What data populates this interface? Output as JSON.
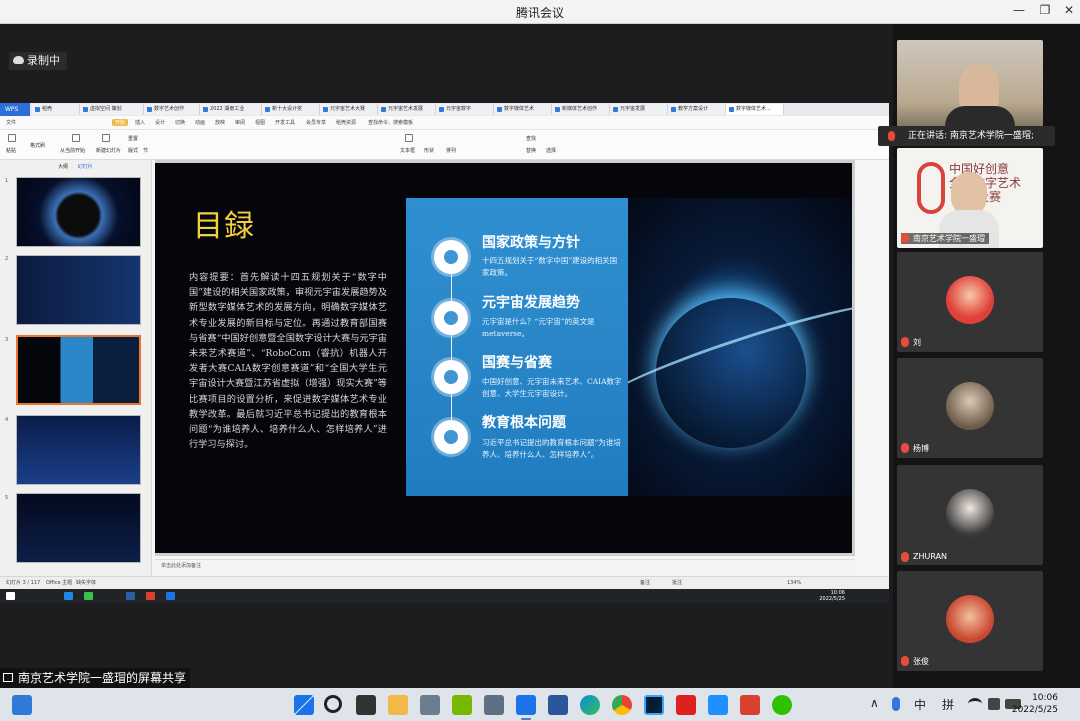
{
  "window": {
    "title": "腾讯会议",
    "controls": [
      "—",
      "❐",
      "✕"
    ]
  },
  "recording": {
    "label": "录制中"
  },
  "share_caption": "南京艺术学院一盛瑁的屏幕共享",
  "speaking": {
    "label": "正在讲话: 南京艺术学院一盛瑁;"
  },
  "wps": {
    "logo": "WPS",
    "tabs": [
      "WPS",
      "稻壳",
      "虚拟空间 策划",
      "数字艺术创作",
      "2022 湖南工业",
      "新十大设计奖",
      "元宇宙艺术大赛",
      "元宇宙艺术发展",
      "元宇宙数字",
      "数字媒体艺术",
      "新媒体艺术创作",
      "元宇宙发展",
      "教学方案设计",
      "数字媒体艺术..."
    ],
    "menu": [
      "文件",
      "开始",
      "插入",
      "设计",
      "切换",
      "动画",
      "放映",
      "审阅",
      "视图",
      "开发工具",
      "会员专享",
      "稻壳资源",
      "查找命令、搜索模板"
    ],
    "active_menu": "开始",
    "ribbon_items": [
      "粘贴",
      "格式刷",
      "从当前开始",
      "新建幻灯片",
      "版式",
      "重置",
      "节",
      "文本框",
      "形状",
      "排列",
      "查找",
      "替换",
      "选择"
    ],
    "panel_tabs": [
      "大纲",
      "幻灯片"
    ],
    "slide_numbers": [
      "1",
      "2",
      "3",
      "4",
      "5"
    ],
    "notes_placeholder": "单击此处添加备注",
    "status": {
      "slide_counter": "幻灯片 3 / 117",
      "theme": "Office 主题",
      "font": "缺失字体",
      "zoom": "134%",
      "notes": "备注",
      "comment": "批注"
    },
    "clock": {
      "time": "10:06",
      "date": "2022/5/25"
    }
  },
  "slide": {
    "title": "目録",
    "body": "内容提要：首先解读十四五规划关于“数字中国”建设的相关国家政策，审视元宇宙发展趋势及新型数字媒体艺术的发展方向，明确数字媒体艺术专业发展的新目标与定位。再通过教育部国赛与省赛“中国好创意暨全国数字设计大赛与元宇宙未来艺术赛道”、“RoboCom（睿抗）机器人开发者大赛CAIA数字创意赛道”和“全国大学生元宇宙设计大赛暨江苏省虚拟（增强）现实大赛”等比赛项目的设置分析，来促进数字媒体艺术专业教学改革。最后就习近平总书记提出的教育根本问题“为谁培养人、培养什么人、怎样培养人”进行学习与探讨。",
    "toc": [
      {
        "heading": "国家政策与方针",
        "desc": "十四五规划关于“数字中国”建设的相关国家政策。"
      },
      {
        "heading": "元宇宙发展趋势",
        "desc": "元宇宙是什么？“元宇宙”的英文是metaverse。"
      },
      {
        "heading": "国赛与省赛",
        "desc": "中国好创意、元宇宙未来艺术、CAIA数字创意、大学生元宇宙设计。"
      },
      {
        "heading": "教育根本问题",
        "desc": "习近平总书记提出的教育根本问题“为谁培养人、培养什么人、怎样培养人”。"
      }
    ]
  },
  "participants": [
    {
      "name": "南京艺术学院一盛瑁",
      "kind": "video"
    },
    {
      "name": "南京艺术学院一盛瑁",
      "kind": "video-board"
    },
    {
      "name": "刘",
      "kind": "avatar",
      "color": "#e0403a"
    },
    {
      "name": "杨博",
      "kind": "avatar",
      "color": "#6b5a48"
    },
    {
      "name": "ZHURAN",
      "kind": "avatar",
      "color": "#3a3a3a"
    },
    {
      "name": "张俊",
      "kind": "avatar",
      "color": "#c9472f"
    }
  ],
  "board_text": {
    "line1": "中国好创意",
    "line2": "全国数字艺术",
    "line3": "大赛"
  },
  "taskbar": {
    "ime": "中",
    "ime2": "拼",
    "clock": {
      "time": "10:06",
      "date": "2022/5/25"
    },
    "overflow": "∧"
  },
  "colors": {
    "accent": "#2d6fd8",
    "slide_title": "#f4d03f",
    "toc_panel": "#2a88c9",
    "active_menu": "#f2b84a"
  }
}
